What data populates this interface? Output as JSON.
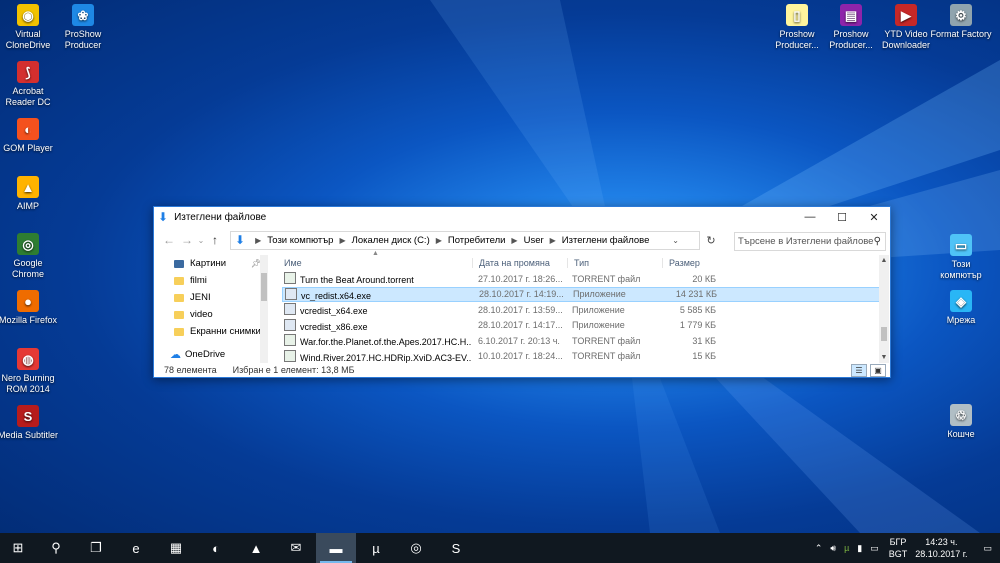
{
  "desktop": {
    "left_icons": [
      {
        "label": "Virtual CloneDrive",
        "icon": "clonedrive-icon",
        "color": "#f2c200",
        "glyph": "◉"
      },
      {
        "label": "ProShow Producer",
        "icon": "proshow-icon",
        "color": "#1e88e5",
        "glyph": "❀"
      },
      {
        "label": "Acrobat Reader DC",
        "icon": "acrobat-icon",
        "color": "#d32f2f",
        "glyph": "⟆"
      },
      {
        "label": "GOM Player",
        "icon": "gom-icon",
        "color": "#f4511e",
        "glyph": "◐"
      },
      {
        "label": "AIMP",
        "icon": "aimp-icon",
        "color": "#ffb300",
        "glyph": "▲"
      },
      {
        "label": "Google Chrome",
        "icon": "chrome-icon",
        "color": "#2e7d32",
        "glyph": "◎"
      },
      {
        "label": "Mozilla Firefox",
        "icon": "firefox-icon",
        "color": "#ef6c00",
        "glyph": "●"
      },
      {
        "label": "Nero Burning ROM 2014",
        "icon": "nero-icon",
        "color": "#e53935",
        "glyph": "◍"
      },
      {
        "label": "Media Subtitler",
        "icon": "subtitler-icon",
        "color": "#b71c1c",
        "glyph": "S"
      }
    ],
    "right_icons": [
      {
        "label": "Proshow Producer...",
        "icon": "file-icon",
        "color": "#fff59d",
        "glyph": "▯"
      },
      {
        "label": "Proshow Producer...",
        "icon": "winrar-icon",
        "color": "#8e24aa",
        "glyph": "▤"
      },
      {
        "label": "YTD Video Downloader",
        "icon": "ytd-icon",
        "color": "#c62828",
        "glyph": "▶"
      },
      {
        "label": "Format Factory",
        "icon": "format-factory-icon",
        "color": "#90a4ae",
        "glyph": "⚙"
      }
    ],
    "side_icons": [
      {
        "label": "Този компютър",
        "icon": "computer-icon",
        "color": "#4fc3f7",
        "glyph": "▭"
      },
      {
        "label": "Мрежа",
        "icon": "network-icon",
        "color": "#29b6f6",
        "glyph": "◈"
      },
      {
        "label": "Кошче",
        "icon": "recycle-bin-icon",
        "color": "#b0bec5",
        "glyph": "♲"
      }
    ]
  },
  "window": {
    "title": "Изтеглени файлове",
    "minimize": "—",
    "maximize": "☐",
    "close": "✕",
    "breadcrumb": [
      "Този компютър",
      "Локален диск (C:)",
      "Потребители",
      "User",
      "Изтеглени файлове"
    ],
    "search_placeholder": "Търсене в Изтеглени файлове",
    "nav_items": [
      {
        "label": "Картини",
        "pinned": true,
        "dark": true
      },
      {
        "label": "filmi",
        "pinned": false,
        "dark": false
      },
      {
        "label": "JENI",
        "pinned": false,
        "dark": false
      },
      {
        "label": "video",
        "pinned": false,
        "dark": false
      },
      {
        "label": "Екранни снимки",
        "pinned": false,
        "dark": false
      }
    ],
    "onedrive": "OneDrive",
    "columns": {
      "name": "Име",
      "date": "Дата на промяна",
      "type": "Тип",
      "size": "Размер"
    },
    "files": [
      {
        "name": "Turn the Beat Around.torrent",
        "date": "27.10.2017 г. 18:26...",
        "type": "TORRENT файл",
        "size": "20 КБ",
        "kind": "torrent",
        "selected": false
      },
      {
        "name": "vc_redist.x64.exe",
        "date": "28.10.2017 г. 14:19...",
        "type": "Приложение",
        "size": "14 231 КБ",
        "kind": "exe",
        "selected": true
      },
      {
        "name": "vcredist_x64.exe",
        "date": "28.10.2017 г. 13:59...",
        "type": "Приложение",
        "size": "5 585 КБ",
        "kind": "exe",
        "selected": false
      },
      {
        "name": "vcredist_x86.exe",
        "date": "28.10.2017 г. 14:17...",
        "type": "Приложение",
        "size": "1 779 КБ",
        "kind": "exe",
        "selected": false
      },
      {
        "name": "War.for.the.Planet.of.the.Apes.2017.HC.H...",
        "date": "6.10.2017 г. 20:13 ч.",
        "type": "TORRENT файл",
        "size": "31 КБ",
        "kind": "torrent",
        "selected": false
      },
      {
        "name": "Wind.River.2017.HC.HDRip.XviD.AC3-EV...",
        "date": "10.10.2017 г. 18:24...",
        "type": "TORRENT файл",
        "size": "15 КБ",
        "kind": "torrent",
        "selected": false
      }
    ],
    "status_count": "78 елемента",
    "status_selected": "Избран е 1 елемент: 13,8 МБ"
  },
  "taskbar": {
    "items": [
      {
        "name": "start-button",
        "glyph": "⊞",
        "active": false
      },
      {
        "name": "search-button",
        "glyph": "⚲",
        "active": false
      },
      {
        "name": "task-view-button",
        "glyph": "❐",
        "active": false
      },
      {
        "name": "edge-button",
        "glyph": "e",
        "active": false
      },
      {
        "name": "store-button",
        "glyph": "▦",
        "active": false
      },
      {
        "name": "gom-taskbar-button",
        "glyph": "◐",
        "active": false
      },
      {
        "name": "vlc-button",
        "glyph": "▲",
        "active": false
      },
      {
        "name": "mail-button",
        "glyph": "✉",
        "active": false
      },
      {
        "name": "file-explorer-button",
        "glyph": "▬",
        "active": true
      },
      {
        "name": "utorrent-button",
        "glyph": "µ",
        "active": false
      },
      {
        "name": "chrome-taskbar-button",
        "glyph": "◎",
        "active": false
      },
      {
        "name": "skype-button",
        "glyph": "S",
        "active": false
      }
    ],
    "tray_arrow": "⌃",
    "lang_top": "БГР",
    "lang_bottom": "BGT",
    "time": "14:23 ч.",
    "date": "28.10.2017 г.",
    "notifications": "▭"
  }
}
